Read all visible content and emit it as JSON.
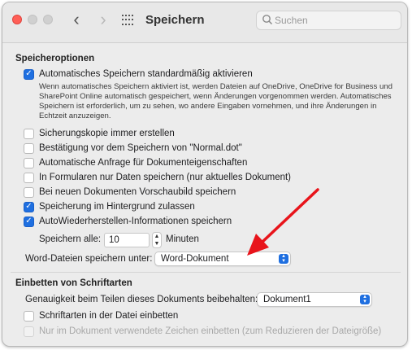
{
  "window": {
    "title": "Speichern"
  },
  "search": {
    "placeholder": "Suchen"
  },
  "save_options": {
    "title": "Speicheroptionen",
    "autosave": {
      "label": "Automatisches Speichern standardmäßig aktivieren",
      "checked": true,
      "description": "Wenn automatisches Speichern aktiviert ist, werden Dateien auf OneDrive, OneDrive for Business und SharePoint Online automatisch gespeichert, wenn Änderungen vorgenommen werden. Automatisches Speichern ist erforderlich, um zu sehen, wo andere Eingaben vornehmen, und ihre Änderungen in Echtzeit anzuzeigen."
    },
    "options": [
      {
        "label": "Sicherungskopie immer erstellen",
        "checked": false
      },
      {
        "label": "Bestätigung vor dem Speichern von \"Normal.dot\"",
        "checked": false
      },
      {
        "label": "Automatische Anfrage für Dokumenteigenschaften",
        "checked": false
      },
      {
        "label": "In Formularen nur Daten speichern (nur aktuelles Dokument)",
        "checked": false
      },
      {
        "label": "Bei neuen Dokumenten Vorschaubild speichern",
        "checked": false
      },
      {
        "label": "Speicherung im Hintergrund zulassen",
        "checked": true
      },
      {
        "label": "AutoWiederherstellen-Informationen speichern",
        "checked": true
      }
    ],
    "save_every": {
      "label": "Speichern alle:",
      "value": "10",
      "unit": "Minuten"
    },
    "save_format": {
      "label": "Word-Dateien speichern unter:",
      "value": "Word-Dokument"
    }
  },
  "embed_fonts": {
    "title": "Einbetten von Schriftarten",
    "fidelity": {
      "label": "Genauigkeit beim Teilen dieses Dokuments beibehalten:",
      "value": "Dokument1"
    },
    "embed": {
      "label": "Schriftarten in der Datei einbetten",
      "checked": false
    },
    "only_used": {
      "label": "Nur im Dokument verwendete Zeichen einbetten (zum Reduzieren der Dateigröße)",
      "checked": false,
      "disabled": true
    }
  },
  "icons": {
    "back": "chevron-left-icon",
    "forward": "chevron-right-icon",
    "show_all": "grid-icon",
    "search": "search-icon"
  },
  "colors": {
    "accent": "#1f6fe0",
    "annotation_arrow": "#e8141b"
  }
}
